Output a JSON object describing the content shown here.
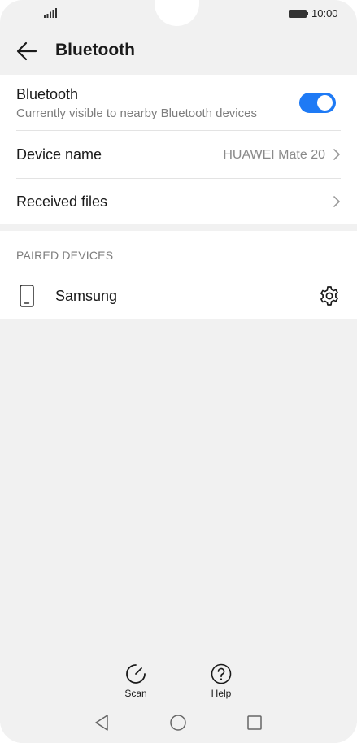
{
  "status": {
    "time": "10:00",
    "signal_icon": "signal-icon",
    "battery_icon": "battery-icon"
  },
  "header": {
    "back_icon": "arrow-left-icon",
    "title": "Bluetooth"
  },
  "bluetooth": {
    "label": "Bluetooth",
    "subtitle": "Currently visible to nearby Bluetooth devices",
    "enabled": true,
    "accent": "#1e7af5"
  },
  "device_name": {
    "label": "Device name",
    "value": "HUAWEI Mate 20"
  },
  "received_files": {
    "label": "Received files"
  },
  "paired": {
    "section_title": "PAIRED DEVICES",
    "devices": [
      {
        "name": "Samsung",
        "icon": "smartphone-icon",
        "settings_icon": "gear-icon"
      }
    ]
  },
  "actions": {
    "scan_label": "Scan",
    "help_label": "Help"
  },
  "nav": {
    "back_icon": "triangle-back-icon",
    "home_icon": "circle-home-icon",
    "recent_icon": "square-recent-icon"
  }
}
